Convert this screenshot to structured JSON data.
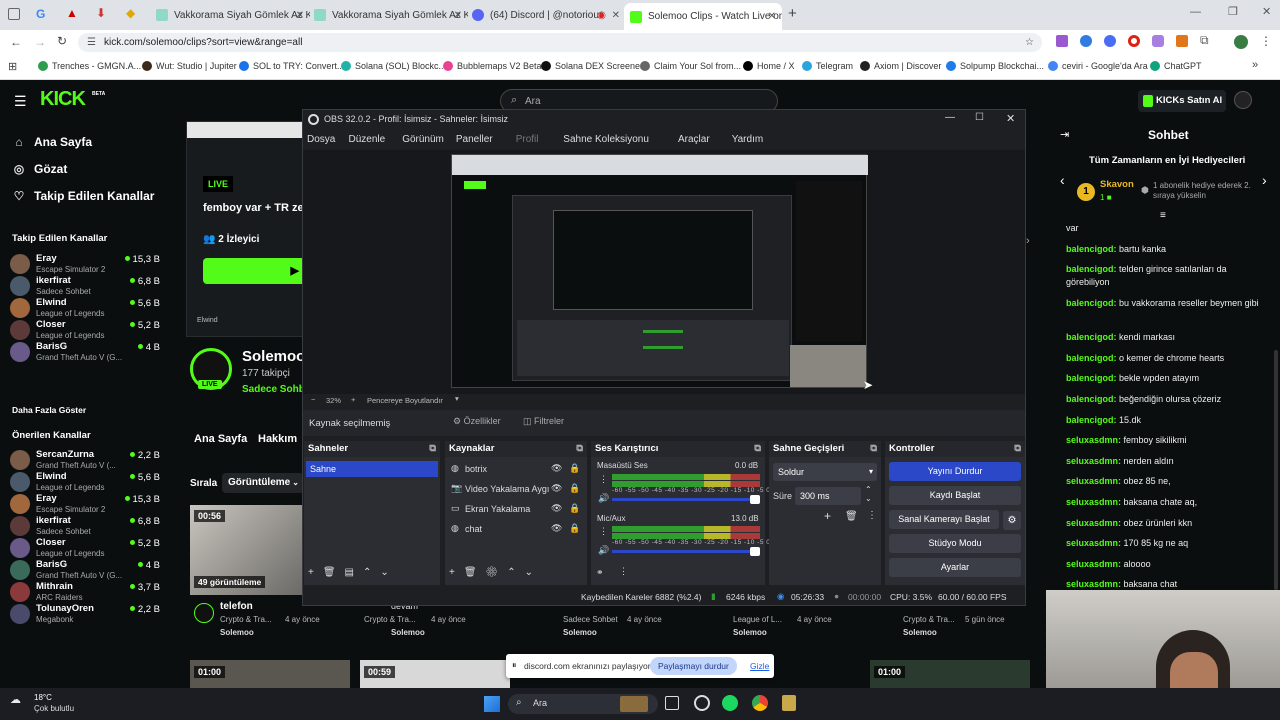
{
  "browser": {
    "tabs": [
      {
        "label": "Vakkorama Siyah Gömlek Az Kul"
      },
      {
        "label": "Vakkorama Siyah Gömlek Az Kul"
      },
      {
        "label": "(64) Discord | @notorious"
      },
      {
        "label": "Solemoo Clips - Watch Live on"
      }
    ],
    "url": "kick.com/solemoo/clips?sort=view&range=all",
    "bookmarks": [
      "Trenches - GMGN.A...",
      "Wut: Studio | Jupiter",
      "SOL to TRY: Convert...",
      "Solana (SOL) Blockc...",
      "Bubblemaps V2 Beta",
      "Solana DEX Screener",
      "Claim Your Sol from...",
      "Home / X",
      "Telegram",
      "Axiom | Discover",
      "Solpump Blockchai...",
      "ceviri - Google'da Ara",
      "ChatGPT"
    ]
  },
  "kick": {
    "logo": "KICK",
    "beta": "BETA",
    "search_placeholder": "Ara",
    "kicks_button": "KICKs Satın Al",
    "nav": [
      "Ana Sayfa",
      "Gözat",
      "Takip Edilen Kanallar"
    ],
    "followed_title": "Takip Edilen Kanallar",
    "followed": [
      {
        "name": "Eray",
        "game": "Escape Simulator 2",
        "viewers": "15,3 B"
      },
      {
        "name": "ikerfirat",
        "game": "Sadece Sohbet",
        "viewers": "6,8 B"
      },
      {
        "name": "Elwind",
        "game": "League of Legends",
        "viewers": "5,6 B"
      },
      {
        "name": "Closer",
        "game": "League of Legends",
        "viewers": "5,2 B"
      },
      {
        "name": "BarisG",
        "game": "Grand Theft Auto V (G...",
        "viewers": "4 B"
      }
    ],
    "show_more": "Daha Fazla Göster",
    "recommended_title": "Önerilen Kanallar",
    "recommended": [
      {
        "name": "SercanZurna",
        "game": "Grand Theft Auto V (...",
        "viewers": "2,2 B"
      },
      {
        "name": "Elwind",
        "game": "League of Legends",
        "viewers": "5,6 B"
      },
      {
        "name": "Eray",
        "game": "Escape Simulator 2",
        "viewers": "15,3 B"
      },
      {
        "name": "ikerfirat",
        "game": "Sadece Sohbet",
        "viewers": "6,8 B"
      },
      {
        "name": "Closer",
        "game": "League of Legends",
        "viewers": "5,2 B"
      },
      {
        "name": "BarisG",
        "game": "Grand Theft Auto V (G...",
        "viewers": "4 B"
      },
      {
        "name": "Mithrain",
        "game": "ARC Raiders",
        "viewers": "3,7 B"
      },
      {
        "name": "TolunayOren",
        "game": "Megabonk",
        "viewers": "2,2 B"
      }
    ],
    "banner": {
      "live": "LIVE",
      "title": "femboy var + TR ze",
      "watchers": "2 İzleyici"
    },
    "channel": {
      "name": "Solemoo",
      "followers": "177 takipçi",
      "category": "Sadece Sohb",
      "live": "LIVE"
    },
    "tabs": [
      "Ana Sayfa",
      "Hakkım"
    ],
    "sort_label": "Sırala",
    "sort_value": "Görüntüleme",
    "clips": [
      {
        "duration": "00:56",
        "views": "49 görüntüleme",
        "title": "telefon",
        "meta": "Crypto & Tra...",
        "age": "4 ay önce",
        "channel": "Solemoo"
      },
      {
        "title": "devam",
        "meta": "Crypto & Tra...",
        "age": "4 ay önce",
        "channel": "Solemoo"
      },
      {
        "meta": "Sadece Sohbet",
        "age": "4 ay önce",
        "channel": "Solemoo"
      },
      {
        "meta": "League of L...",
        "age": "4 ay önce",
        "channel": "Solemoo"
      },
      {
        "meta": "Crypto & Tra...",
        "age": "5 gün önce",
        "channel": "Solemoo"
      }
    ],
    "bottom_durations": [
      "01:00",
      "00:59",
      "01:00"
    ],
    "chat": {
      "title": "Sohbet",
      "gifters_title": "Tüm Zamanların en İyi Hediyecileri",
      "gifter_name": "Skavon",
      "gifter_count": "1",
      "gifter_rank": "1",
      "gifter_hint": "1 abonelik hediye ederek 2. sıraya yükselin",
      "messages": [
        {
          "user": "",
          "text": "var"
        },
        {
          "user": "balencigod:",
          "text": "bartu kanka"
        },
        {
          "user": "balencigod:",
          "text": "telden girince satılanları da görebiliyon"
        },
        {
          "user": "balencigod:",
          "text": "bu vakkorama reseller beymen gibi"
        },
        {
          "user": "balencigod:",
          "text": "kendi markası"
        },
        {
          "user": "balencigod:",
          "text": "o kemer de chrome hearts"
        },
        {
          "user": "balencigod:",
          "text": "bekle wpden atayım"
        },
        {
          "user": "balencigod:",
          "text": "beğendiğin olursa çözeriz"
        },
        {
          "user": "balencigod:",
          "text": "15.dk"
        },
        {
          "user": "seluxasdmn:",
          "text": "femboy sikilikmi"
        },
        {
          "user": "seluxasdmn:",
          "text": "nerden aldın"
        },
        {
          "user": "seluxasdmn:",
          "text": "obez 85 ne,"
        },
        {
          "user": "seluxasdmn:",
          "text": "baksana chate aq,"
        },
        {
          "user": "seluxasdmn:",
          "text": "obez ürünleri kkn"
        },
        {
          "user": "seluxasdmn:",
          "text": "170 85 kg ne aq"
        },
        {
          "user": "seluxasdmn:",
          "text": "aloooo"
        },
        {
          "user": "seluxasdmn:",
          "text": "baksana chat"
        }
      ]
    }
  },
  "obs": {
    "title": "OBS 32.0.2 - Profil: İsimsiz - Sahneler: İsimsiz",
    "menu": [
      "Dosya",
      "Düzenle",
      "Görünüm",
      "Paneller",
      "Profil",
      "Sahne Koleksiyonu",
      "Araçlar",
      "Yardım"
    ],
    "zoom": "32%",
    "fit_label": "Pencereye Boyutlandır",
    "no_source": "Kaynak seçilmemiş",
    "properties": "Özellikler",
    "filters": "Filtreler",
    "docks": {
      "scenes": "Sahneler",
      "sources": "Kaynaklar",
      "mixer": "Ses Karıştırıcı",
      "transitions": "Sahne Geçişleri",
      "controls": "Kontroller"
    },
    "scenes": [
      "Sahne"
    ],
    "sources": [
      "botrix",
      "Video Yakalama Aygı",
      "Ekran Yakalama",
      "chat"
    ],
    "mixer": [
      {
        "name": "Masaüstü Ses",
        "db": "0.0 dB"
      },
      {
        "name": "Mic/Aux",
        "db": "13.0 dB"
      }
    ],
    "meter_scale": "-60 -55 -50 -45 -40 -35 -30 -25 -20 -15 -10 -5 0",
    "transition": "Soldur",
    "duration_label": "Süre",
    "duration_value": "300 ms",
    "controls": [
      "Yayını Durdur",
      "Kaydı Başlat",
      "Sanal Kamerayı Başlat",
      "Stüdyo Modu",
      "Ayarlar"
    ],
    "status": {
      "dropped": "Kaybedilen Kareler 6882 (%2.4)",
      "bitrate": "6246 kbps",
      "live_time": "05:26:33",
      "rec_time": "00:00:00",
      "cpu": "CPU: 3.5%",
      "fps": "60.00 / 60.00 FPS"
    }
  },
  "share_bar": {
    "text": "discord.com ekranınızı paylaşıyor.",
    "stop": "Paylaşmayı durdur",
    "hide": "Gizle"
  },
  "taskbar": {
    "temp": "18°C",
    "weather": "Çok bulutlu",
    "search": "Ara"
  },
  "colors": {
    "kick_green": "#53fc18",
    "obs_blue": "#2a48c8"
  }
}
